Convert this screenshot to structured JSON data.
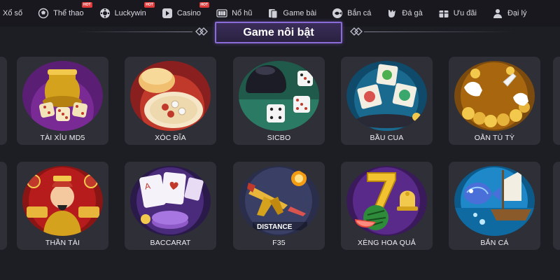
{
  "nav": {
    "items": [
      {
        "label": "Xổ số",
        "icon": "lottery-icon",
        "badge": ""
      },
      {
        "label": "Thể thao",
        "icon": "football-icon",
        "badge": "HOT"
      },
      {
        "label": "Luckywin",
        "icon": "luckywin-icon",
        "badge": "HOT"
      },
      {
        "label": "Casino",
        "icon": "play-icon",
        "badge": "HOT"
      },
      {
        "label": "Nổ hũ",
        "icon": "slot-icon",
        "badge": ""
      },
      {
        "label": "Game bài",
        "icon": "cards-icon",
        "badge": ""
      },
      {
        "label": "Bắn cá",
        "icon": "fish-icon",
        "badge": ""
      },
      {
        "label": "Đá gà",
        "icon": "rooster-icon",
        "badge": ""
      },
      {
        "label": "Ưu đãi",
        "icon": "gift-icon",
        "badge": ""
      },
      {
        "label": "Đại lý",
        "icon": "agent-icon",
        "badge": ""
      }
    ]
  },
  "section": {
    "title": "Game nôi bật"
  },
  "games": [
    {
      "label": "TÀI XỈU MD5",
      "theme": "taixiu"
    },
    {
      "label": "XÓC ĐĨA",
      "theme": "xocdia"
    },
    {
      "label": "SICBO",
      "theme": "sicbo"
    },
    {
      "label": "BẦU CUA",
      "theme": "baucua"
    },
    {
      "label": "OẰN TÙ TỲ",
      "theme": "oantuty"
    },
    {
      "label": "THẦN TÀI",
      "theme": "thantai"
    },
    {
      "label": "BACCARAT",
      "theme": "baccarat"
    },
    {
      "label": "F35",
      "theme": "f35"
    },
    {
      "label": "XÈNG HOA QUẢ",
      "theme": "xeng"
    },
    {
      "label": "BẮN CÁ",
      "theme": "banca"
    }
  ],
  "thumb_text": {
    "f35_caption": "DISTANCE"
  },
  "colors": {
    "accent": "#8a6bd8",
    "card_bg": "#2f2f38",
    "page_bg": "#1d1d24",
    "badge": "#e03a3a"
  }
}
